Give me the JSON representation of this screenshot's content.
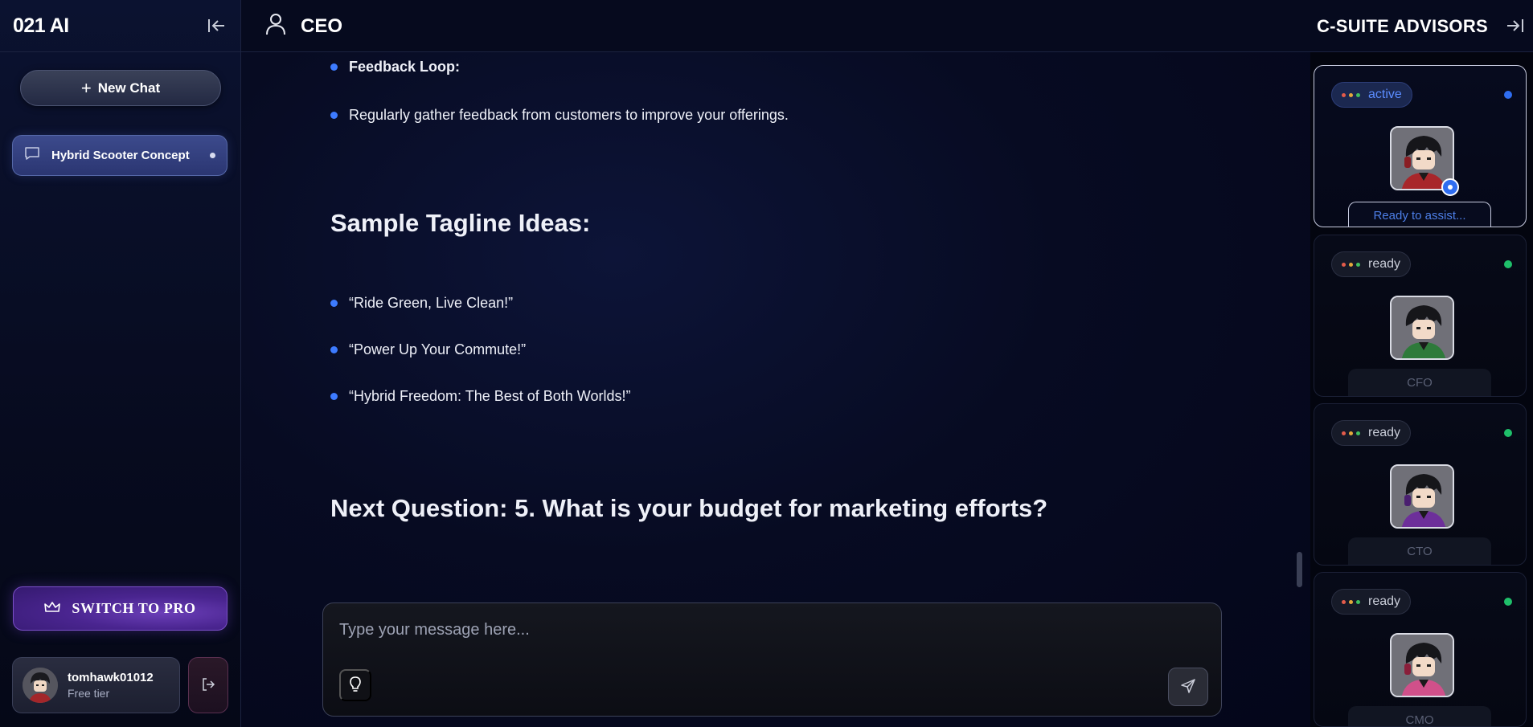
{
  "sidebar": {
    "brand": "021 AI",
    "new_chat_label": "New Chat",
    "chats": [
      {
        "label": "Hybrid Scooter Concept"
      }
    ],
    "pro_label": "SWITCH TO PRO",
    "user": {
      "name": "tomhawk01012",
      "tier": "Free tier"
    }
  },
  "header": {
    "persona": "CEO",
    "advisors_title": "C-SUITE ADVISORS"
  },
  "conversation": {
    "feedback_title": "Feedback Loop:",
    "feedback_text": "Regularly gather feedback from customers to improve your offerings.",
    "tagline_heading": "Sample Tagline Ideas:",
    "taglines": [
      "“Ride Green, Live Clean!”",
      "“Power Up Your Commute!”",
      "“Hybrid Freedom: The Best of Both Worlds!”"
    ],
    "next_question": "Next Question: 5. What is your budget for marketing efforts?"
  },
  "composer": {
    "placeholder": "Type your message here..."
  },
  "advisors": [
    {
      "status": "active",
      "role_text": "Ready to assist...",
      "status_color": "#2f6df0",
      "active": true
    },
    {
      "status": "ready",
      "role_text": "CFO",
      "status_color": "#1fbf6a",
      "active": false
    },
    {
      "status": "ready",
      "role_text": "CTO",
      "status_color": "#1fbf6a",
      "active": false
    },
    {
      "status": "ready",
      "role_text": "CMO",
      "status_color": "#1fbf6a",
      "active": false
    }
  ],
  "colors": {
    "accent": "#3d7bff",
    "pro_purple": "#4a2590",
    "ready_green": "#1fbf6a"
  }
}
